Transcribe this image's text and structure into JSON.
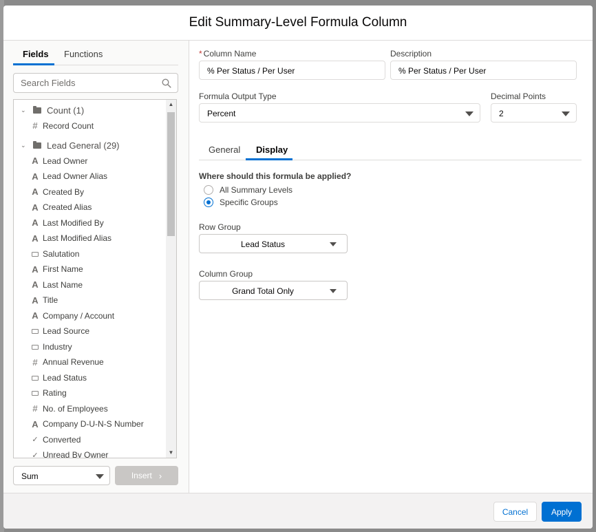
{
  "modal": {
    "title": "Edit Summary-Level Formula Column"
  },
  "left": {
    "tabs": [
      {
        "label": "Fields"
      },
      {
        "label": "Functions"
      }
    ],
    "search": {
      "placeholder": "Search Fields",
      "value": ""
    },
    "groups": [
      {
        "label": "Count (1)",
        "items": [
          {
            "icon": "hash-icon",
            "label": "Record Count"
          }
        ]
      },
      {
        "label": "Lead General (29)",
        "items": [
          {
            "icon": "text-icon",
            "label": "Lead Owner"
          },
          {
            "icon": "text-icon",
            "label": "Lead Owner Alias"
          },
          {
            "icon": "text-icon",
            "label": "Created By"
          },
          {
            "icon": "text-icon",
            "label": "Created Alias"
          },
          {
            "icon": "text-icon",
            "label": "Last Modified By"
          },
          {
            "icon": "text-icon",
            "label": "Last Modified Alias"
          },
          {
            "icon": "picklist-icon",
            "label": "Salutation"
          },
          {
            "icon": "text-icon",
            "label": "First Name"
          },
          {
            "icon": "text-icon",
            "label": "Last Name"
          },
          {
            "icon": "text-icon",
            "label": "Title"
          },
          {
            "icon": "text-icon",
            "label": "Company / Account"
          },
          {
            "icon": "picklist-icon",
            "label": "Lead Source"
          },
          {
            "icon": "picklist-icon",
            "label": "Industry"
          },
          {
            "icon": "hash-icon",
            "label": "Annual Revenue"
          },
          {
            "icon": "picklist-icon",
            "label": "Lead Status"
          },
          {
            "icon": "picklist-icon",
            "label": "Rating"
          },
          {
            "icon": "hash-icon",
            "label": "No. of Employees"
          },
          {
            "icon": "text-icon",
            "label": "Company D-U-N-S Number"
          },
          {
            "icon": "checkbox-icon",
            "label": "Converted"
          },
          {
            "icon": "checkbox-icon",
            "label": "Unread By Owner"
          }
        ]
      }
    ],
    "aggregate": {
      "value": "Sum"
    },
    "insert_label": "Insert"
  },
  "right": {
    "column_name": {
      "label": "Column Name",
      "value": "% Per Status / Per User"
    },
    "description": {
      "label": "Description",
      "value": "% Per Status / Per User"
    },
    "output_type": {
      "label": "Formula Output Type",
      "value": "Percent"
    },
    "decimal_points": {
      "label": "Decimal Points",
      "value": "2"
    },
    "tabs": [
      {
        "label": "General"
      },
      {
        "label": "Display"
      }
    ],
    "question": "Where should this formula be applied?",
    "options": [
      {
        "label": "All Summary Levels",
        "checked": false
      },
      {
        "label": "Specific Groups",
        "checked": true
      }
    ],
    "row_group": {
      "label": "Row Group",
      "value": "Lead Status"
    },
    "column_group": {
      "label": "Column Group",
      "value": "Grand Total Only"
    }
  },
  "footer": {
    "cancel_label": "Cancel",
    "apply_label": "Apply"
  },
  "colors": {
    "accent": "#0070d2",
    "required": "#c23934"
  }
}
